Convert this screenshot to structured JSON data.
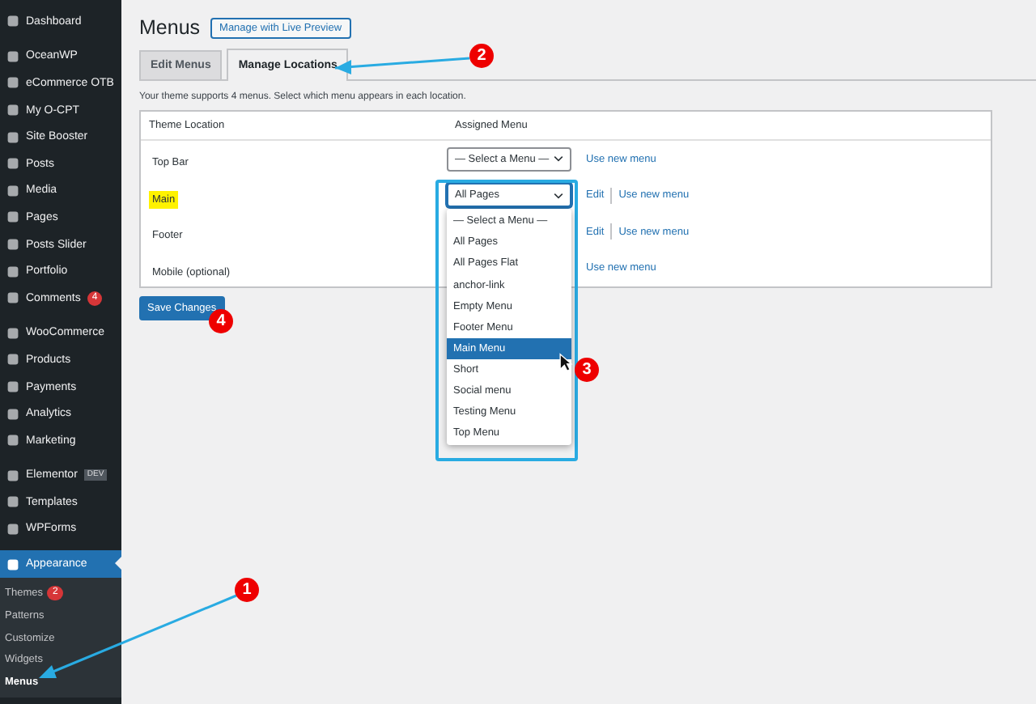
{
  "sidebar": {
    "sections": [
      [
        {
          "label": "Dashboard",
          "selected": false
        }
      ],
      [
        {
          "label": "OceanWP",
          "selected": false
        },
        {
          "label": "eCommerce OTB",
          "selected": false
        },
        {
          "label": "My O-CPT",
          "selected": false
        },
        {
          "label": "Site Booster",
          "selected": false
        },
        {
          "label": "Posts",
          "selected": false
        },
        {
          "label": "Media",
          "selected": false
        },
        {
          "label": "Pages",
          "selected": false
        },
        {
          "label": "Posts Slider",
          "selected": false
        },
        {
          "label": "Portfolio",
          "selected": false
        },
        {
          "label": "Comments",
          "selected": false,
          "badge": "4"
        }
      ],
      [
        {
          "label": "WooCommerce",
          "selected": false
        },
        {
          "label": "Products",
          "selected": false
        },
        {
          "label": "Payments",
          "selected": false
        },
        {
          "label": "Analytics",
          "selected": false
        },
        {
          "label": "Marketing",
          "selected": false
        }
      ],
      [
        {
          "label": "Elementor",
          "selected": false,
          "tag": "DEV"
        },
        {
          "label": "Templates",
          "selected": false
        },
        {
          "label": "WPForms",
          "selected": false
        }
      ],
      [
        {
          "label": "Appearance",
          "selected": true,
          "children": [
            {
              "label": "Themes",
              "selected": false,
              "badge": "2"
            },
            {
              "label": "Patterns",
              "selected": false
            },
            {
              "label": "Customize",
              "selected": false
            },
            {
              "label": "Widgets",
              "selected": false
            },
            {
              "label": "Menus",
              "selected": true
            }
          ]
        }
      ]
    ]
  },
  "page": {
    "title": "Menus",
    "action": "Manage with Live Preview"
  },
  "tabs": [
    {
      "label": "Edit Menus",
      "selected": false
    },
    {
      "label": "Manage Locations",
      "selected": true
    }
  ],
  "description": "Your theme supports 4 menus. Select which menu appears in each location.",
  "table": {
    "columns": [
      "Theme Location",
      "Assigned Menu"
    ],
    "rows": [
      {
        "location": "Top Bar",
        "highlighted": false,
        "menu": "— Select a Menu —",
        "links": [
          "Use new menu"
        ]
      },
      {
        "location": "Main",
        "highlighted": true,
        "menu": "All Pages",
        "links": [
          "Edit",
          "Use new menu"
        ],
        "open": true
      },
      {
        "location": "Footer",
        "highlighted": false,
        "links": [
          "Edit",
          "Use new menu"
        ]
      },
      {
        "location": "Mobile (optional)",
        "highlighted": false,
        "links": [
          "Use new menu"
        ]
      }
    ]
  },
  "dropdown": {
    "options": [
      {
        "label": "— Select a Menu —",
        "selected": false
      },
      {
        "label": "All Pages",
        "selected": false
      },
      {
        "label": "All Pages Flat",
        "selected": false
      },
      {
        "label": "anchor-link",
        "selected": false
      },
      {
        "label": "Empty Menu",
        "selected": false
      },
      {
        "label": "Footer Menu",
        "selected": false
      },
      {
        "label": "Main Menu",
        "selected": true
      },
      {
        "label": "Short",
        "selected": false
      },
      {
        "label": "Social menu",
        "selected": false
      },
      {
        "label": "Testing Menu",
        "selected": false
      },
      {
        "label": "Top Menu",
        "selected": false
      }
    ]
  },
  "save_button": "Save Changes",
  "annotations": [
    {
      "label": "1"
    },
    {
      "label": "2"
    },
    {
      "label": "3"
    },
    {
      "label": "4"
    }
  ]
}
